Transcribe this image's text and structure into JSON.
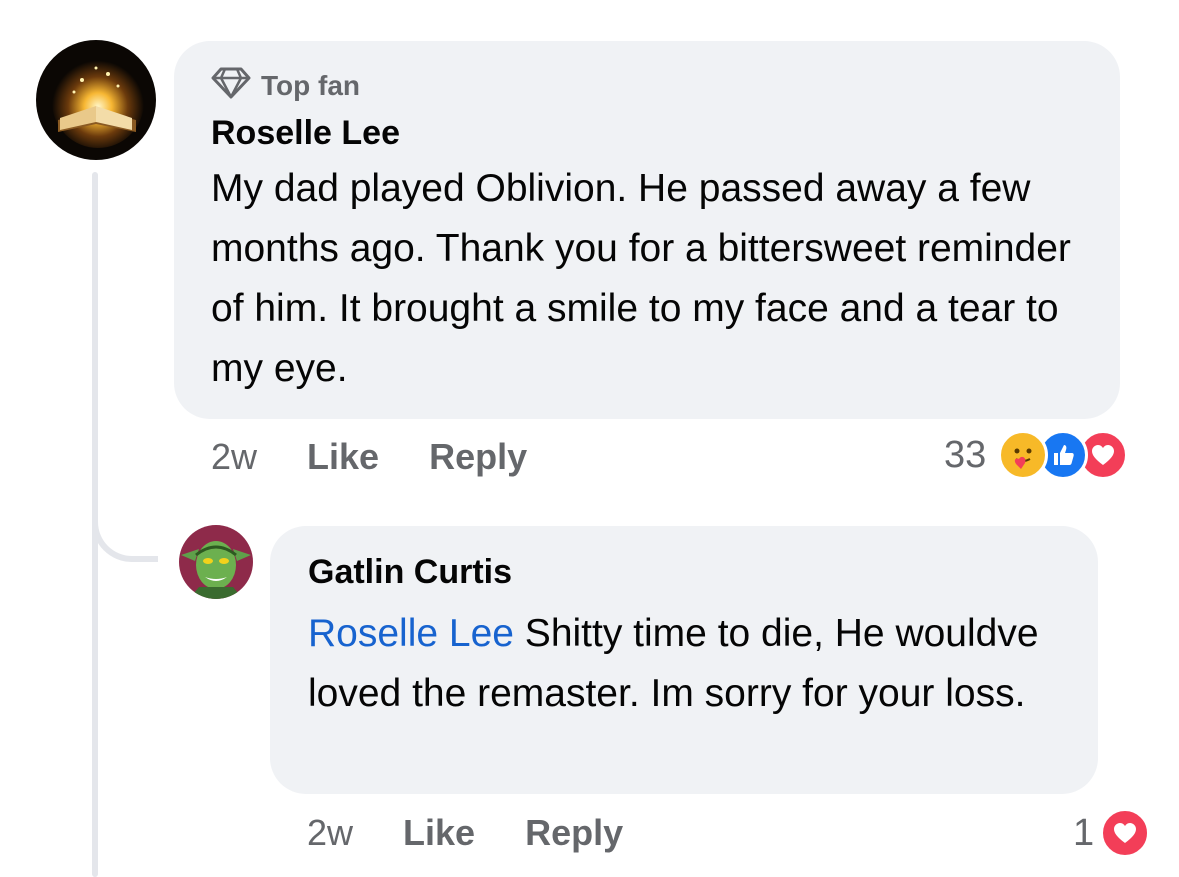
{
  "comments": [
    {
      "badge_label": "Top fan",
      "badge_icon": "diamond-icon",
      "author": "Roselle Lee",
      "text": "My dad played Oblivion. He passed away a few months ago. Thank you for a bittersweet reminder of him. It brought a smile to my face and a tear to my eye.",
      "time": "2w",
      "like_label": "Like",
      "reply_label": "Reply",
      "reaction_count": "33",
      "reactions": [
        "care-reaction-icon",
        "like-reaction-icon",
        "love-reaction-icon"
      ],
      "avatar": "glowing-book-avatar"
    },
    {
      "author": "Gatlin Curtis",
      "mention": "Roselle Lee",
      "text": " Shitty time to die, He wouldve loved the remaster. Im sorry for your loss.",
      "time": "2w",
      "like_label": "Like",
      "reply_label": "Reply",
      "reaction_count": "1",
      "reactions": [
        "love-reaction-icon"
      ],
      "avatar": "goblin-avatar"
    }
  ],
  "colors": {
    "bubble": "#f0f2f5",
    "secondary_text": "#65676b",
    "mention": "#1763cf",
    "like_blue": "#1877f2",
    "love_red": "#f33e58",
    "care_yellow": "#f7b928"
  }
}
